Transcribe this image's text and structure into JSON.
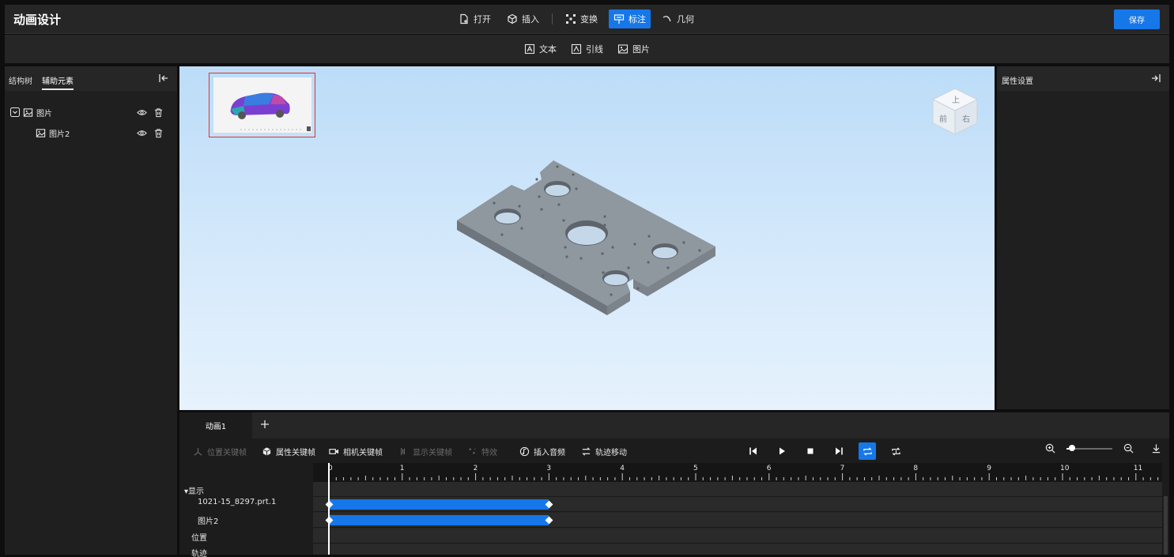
{
  "header": {
    "title": "动画设计",
    "tools": [
      {
        "label": "打开",
        "icon": "file-open-icon"
      },
      {
        "label": "插入",
        "icon": "cube-icon"
      },
      {
        "label": "变换",
        "icon": "transform-icon"
      },
      {
        "label": "标注",
        "icon": "annotation-icon",
        "active": true
      },
      {
        "label": "几何",
        "icon": "arc-icon"
      }
    ],
    "save_label": "保存"
  },
  "subtoolbar": {
    "items": [
      {
        "label": "文本",
        "icon": "text-icon"
      },
      {
        "label": "引线",
        "icon": "leader-icon"
      },
      {
        "label": "图片",
        "icon": "image-icon"
      }
    ]
  },
  "left_panel": {
    "tabs": [
      {
        "label": "结构树",
        "active": false
      },
      {
        "label": "辅助元素",
        "active": true
      }
    ],
    "tree": [
      {
        "label": "图片",
        "level": 0,
        "expanded": true
      },
      {
        "label": "图片2",
        "level": 1
      }
    ]
  },
  "right_panel": {
    "title": "属性设置"
  },
  "viewcube": {
    "top": "上",
    "front": "前",
    "right": "右"
  },
  "timeline": {
    "tabs": [
      {
        "label": "动画1",
        "active": true
      }
    ],
    "toolbar": [
      {
        "label": "位置关键帧",
        "enabled": false,
        "icon": "position-key-icon"
      },
      {
        "label": "属性关键帧",
        "enabled": true,
        "icon": "cube-icon"
      },
      {
        "label": "相机关键帧",
        "enabled": true,
        "icon": "camera-icon"
      },
      {
        "label": "显示关键帧",
        "enabled": false,
        "icon": "display-key-icon"
      },
      {
        "label": "特效",
        "enabled": false,
        "icon": "effect-icon"
      },
      {
        "label": "插入音频",
        "enabled": true,
        "icon": "audio-icon"
      },
      {
        "label": "轨迹移动",
        "enabled": true,
        "icon": "track-move-icon"
      }
    ],
    "loop_active": true,
    "zoom_level": 0.12,
    "ruler_ticks": [
      "0",
      "1",
      "2",
      "3",
      "4",
      "5",
      "6",
      "7",
      "8",
      "9",
      "10",
      "11"
    ],
    "tracks": [
      {
        "label": "▾显示",
        "level": 0
      },
      {
        "label": "1021-15_8297.prt.1",
        "level": 1,
        "start": 0,
        "end": 3
      },
      {
        "label": "图片2",
        "level": 1,
        "start": 0,
        "end": 3
      },
      {
        "label": "位置",
        "level": 0
      },
      {
        "label": "轨迹",
        "level": 0
      }
    ],
    "playhead_time": 0
  }
}
